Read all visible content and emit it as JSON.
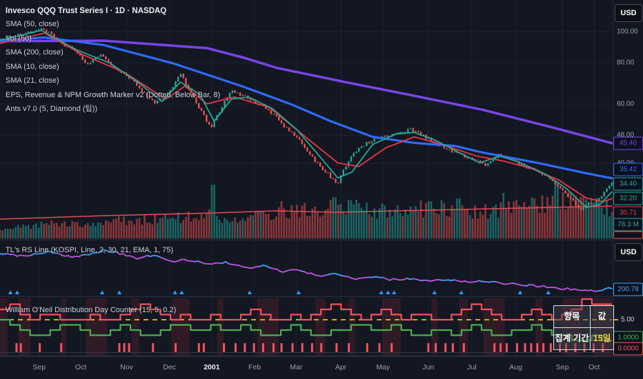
{
  "header": {
    "title": "Invesco QQQ Trust Series I · 1D · NASDAQ"
  },
  "legend": {
    "items": [
      "SMA (50, close)",
      "Vol (50)",
      "SMA (200, close)",
      "SMA (10, close)",
      "SMA (21, close)",
      "EPS, Revenue & NPM Growth Marker v2 (Dotted, Below Bar, 8)",
      "Ants v7.0 (5, Diamond (팁))"
    ]
  },
  "pane_labels": {
    "rs": "TL's RS Line (KOSPI, Line, 2, 30, 21, EMA, 1, 75)",
    "dd": "William O'Neil Distribution Day Counter (15, 5, 0.2)"
  },
  "axis": {
    "currency_main": "USD",
    "currency_rs": "USD"
  },
  "table": {
    "header": [
      "항목",
      "값"
    ],
    "rows": [
      [
        "집계 기간",
        "15일"
      ]
    ]
  },
  "colors": {
    "bg": "#131722",
    "grid": "#1d2330",
    "divider": "#262b38",
    "up": "#26a69a",
    "down": "#ef5350",
    "sma200": "#7646e6",
    "sma50": "#2f6bff",
    "sma21": "#f23645",
    "sma10": "#22ab94",
    "volma": "#e84a5a",
    "rs_blue": "#45a3ff",
    "rs_purple": "#c353e0",
    "triangle": "#2d9cff",
    "dd_red": "#f7525f",
    "dd_green": "#4caf50",
    "dashed": "#e8a408",
    "badge_text_up": "#3dd2b8",
    "yellow": "#f5d342"
  },
  "chart_data": [
    {
      "type": "candlestick",
      "symbol": "Invesco QQQ Trust Series I",
      "interval": "1D",
      "exchange": "NASDAQ",
      "y_scale": "log",
      "y_ticks": [
        {
          "label": "100.00",
          "y": 46
        },
        {
          "label": "80.00",
          "y": 91
        },
        {
          "label": "60.00",
          "y": 151
        },
        {
          "label": "48.00",
          "y": 196
        },
        {
          "label": "40.00",
          "y": 237
        }
      ],
      "x_labels": [
        {
          "label": "Sep",
          "f": 0.064
        },
        {
          "label": "Oct",
          "f": 0.132
        },
        {
          "label": "Nov",
          "f": 0.207
        },
        {
          "label": "Dec",
          "f": 0.277
        },
        {
          "label": "2001",
          "f": 0.346,
          "major": true
        },
        {
          "label": "Feb",
          "f": 0.416
        },
        {
          "label": "Mar",
          "f": 0.484
        },
        {
          "label": "Apr",
          "f": 0.557
        },
        {
          "label": "May",
          "f": 0.626
        },
        {
          "label": "Jun",
          "f": 0.7
        },
        {
          "label": "Jul",
          "f": 0.771
        },
        {
          "label": "Aug",
          "f": 0.843
        },
        {
          "label": "Sep",
          "f": 0.919
        },
        {
          "label": "Oct",
          "f": 0.971
        }
      ],
      "price_anchors": [
        [
          0,
          95
        ],
        [
          0.051,
          99.5
        ],
        [
          0.073,
          102
        ],
        [
          0.096,
          93
        ],
        [
          0.124,
          87
        ],
        [
          0.141,
          79
        ],
        [
          0.163,
          85
        ],
        [
          0.18,
          79
        ],
        [
          0.209,
          73
        ],
        [
          0.231,
          66
        ],
        [
          0.254,
          60
        ],
        [
          0.276,
          65
        ],
        [
          0.295,
          74
        ],
        [
          0.321,
          60
        ],
        [
          0.344,
          50.5
        ],
        [
          0.359,
          57
        ],
        [
          0.378,
          66
        ],
        [
          0.4,
          63
        ],
        [
          0.423,
          60
        ],
        [
          0.445,
          56
        ],
        [
          0.468,
          50.5
        ],
        [
          0.49,
          46
        ],
        [
          0.513,
          40.5
        ],
        [
          0.53,
          37.5
        ],
        [
          0.552,
          34
        ],
        [
          0.566,
          39
        ],
        [
          0.586,
          44
        ],
        [
          0.614,
          47
        ],
        [
          0.643,
          48.5
        ],
        [
          0.671,
          50
        ],
        [
          0.699,
          47
        ],
        [
          0.727,
          44
        ],
        [
          0.75,
          42
        ],
        [
          0.772,
          40.5
        ],
        [
          0.795,
          38.5
        ],
        [
          0.814,
          42
        ],
        [
          0.843,
          39.5
        ],
        [
          0.874,
          37.5
        ],
        [
          0.902,
          35
        ],
        [
          0.925,
          31.5
        ],
        [
          0.949,
          28.5
        ],
        [
          0.964,
          29.5
        ],
        [
          0.979,
          30.5
        ],
        [
          0.992,
          33
        ],
        [
          1,
          34.4
        ]
      ],
      "overlays": {
        "sma200": [
          [
            0,
            93.5
          ],
          [
            0.169,
            93.8
          ],
          [
            0.338,
            89
          ],
          [
            0.4,
            83
          ],
          [
            0.451,
            77.5
          ],
          [
            0.564,
            70
          ],
          [
            0.677,
            63.5
          ],
          [
            0.789,
            57.5
          ],
          [
            0.902,
            50.8
          ],
          [
            1,
            45.4
          ]
        ],
        "sma50": [
          [
            0,
            94
          ],
          [
            0.073,
            96
          ],
          [
            0.169,
            91
          ],
          [
            0.282,
            80
          ],
          [
            0.395,
            68
          ],
          [
            0.474,
            60
          ],
          [
            0.541,
            53
          ],
          [
            0.609,
            47.5
          ],
          [
            0.677,
            45.5
          ],
          [
            0.744,
            44.5
          ],
          [
            0.789,
            42.5
          ],
          [
            0.879,
            39.5
          ],
          [
            0.958,
            36.7
          ],
          [
            1,
            35.42
          ]
        ],
        "sma21": [
          [
            0,
            92
          ],
          [
            0.073,
            99
          ],
          [
            0.135,
            85
          ],
          [
            0.203,
            75
          ],
          [
            0.271,
            62
          ],
          [
            0.302,
            68
          ],
          [
            0.338,
            60
          ],
          [
            0.383,
            63
          ],
          [
            0.44,
            58.5
          ],
          [
            0.496,
            48
          ],
          [
            0.552,
            39.5
          ],
          [
            0.586,
            38.5
          ],
          [
            0.631,
            44
          ],
          [
            0.677,
            47.5
          ],
          [
            0.722,
            45
          ],
          [
            0.778,
            41.5
          ],
          [
            0.823,
            40
          ],
          [
            0.868,
            38
          ],
          [
            0.913,
            35
          ],
          [
            0.958,
            30.8
          ],
          [
            0.986,
            30
          ],
          [
            1,
            30.71
          ]
        ],
        "sma10": [
          [
            0,
            94
          ],
          [
            0.068,
            101
          ],
          [
            0.124,
            88
          ],
          [
            0.18,
            80
          ],
          [
            0.225,
            70
          ],
          [
            0.265,
            61
          ],
          [
            0.295,
            70
          ],
          [
            0.327,
            64
          ],
          [
            0.35,
            53
          ],
          [
            0.378,
            62
          ],
          [
            0.406,
            63
          ],
          [
            0.445,
            58
          ],
          [
            0.485,
            50
          ],
          [
            0.524,
            41
          ],
          [
            0.552,
            35.5
          ],
          [
            0.575,
            37
          ],
          [
            0.609,
            45
          ],
          [
            0.648,
            48.5
          ],
          [
            0.677,
            49
          ],
          [
            0.71,
            46.5
          ],
          [
            0.75,
            42.5
          ],
          [
            0.784,
            39.5
          ],
          [
            0.817,
            41.5
          ],
          [
            0.851,
            39.5
          ],
          [
            0.891,
            36.5
          ],
          [
            0.925,
            33
          ],
          [
            0.958,
            28.8
          ],
          [
            0.981,
            29.5
          ],
          [
            1,
            32.2
          ]
        ]
      },
      "volume": {
        "anchors": [
          [
            0,
            14
          ],
          [
            0.05,
            18
          ],
          [
            0.1,
            22
          ],
          [
            0.15,
            20
          ],
          [
            0.2,
            26
          ],
          [
            0.25,
            28
          ],
          [
            0.3,
            30
          ],
          [
            0.34,
            34
          ],
          [
            0.36,
            30
          ],
          [
            0.4,
            32
          ],
          [
            0.45,
            36
          ],
          [
            0.48,
            38
          ],
          [
            0.52,
            42
          ],
          [
            0.55,
            46
          ],
          [
            0.58,
            42
          ],
          [
            0.62,
            40
          ],
          [
            0.65,
            38
          ],
          [
            0.68,
            42
          ],
          [
            0.72,
            44
          ],
          [
            0.75,
            40
          ],
          [
            0.8,
            38
          ],
          [
            0.85,
            46
          ],
          [
            0.9,
            52
          ],
          [
            0.94,
            56
          ],
          [
            0.97,
            48
          ],
          [
            1,
            42
          ]
        ],
        "spikes": [
          [
            0.349,
            78,
            "up"
          ],
          [
            0.46,
            54,
            "down"
          ],
          [
            0.545,
            60,
            "up"
          ],
          [
            0.582,
            56,
            "up"
          ],
          [
            0.703,
            54,
            "up"
          ],
          [
            0.748,
            58,
            "up"
          ],
          [
            0.823,
            66,
            "up"
          ],
          [
            0.908,
            82,
            "up"
          ],
          [
            0.952,
            60,
            "down"
          ]
        ],
        "ma_anchors": [
          [
            0,
            29
          ],
          [
            0.17,
            34
          ],
          [
            0.35,
            38
          ],
          [
            0.45,
            41
          ],
          [
            0.55,
            39
          ],
          [
            0.65,
            41
          ],
          [
            0.75,
            43
          ],
          [
            0.85,
            45
          ],
          [
            1,
            48
          ]
        ],
        "last": "78.3 M"
      },
      "last_values": {
        "close": "34.40",
        "sma200": "45.40",
        "sma50": "35.42",
        "sma10": "32.20",
        "sma21": "30.71",
        "volume": "78.3 M"
      },
      "badges": [
        {
          "label": "45.40",
          "color": "sma200",
          "y": 208
        },
        {
          "label": "35.42",
          "color": "sma50",
          "y": 246
        },
        {
          "label": "34.40",
          "color": "up",
          "y": 267
        },
        {
          "label": "32.20",
          "color": "sma10",
          "y": 288
        },
        {
          "label": "30.71",
          "color": "sma21",
          "y": 309
        },
        {
          "label": "78.3 M",
          "color": "up",
          "y": 326
        }
      ]
    },
    {
      "type": "line",
      "name": "TL's RS Line",
      "params": [
        "KOSPI",
        "Line",
        2,
        30,
        21,
        "EMA",
        1,
        75
      ],
      "anchors": [
        [
          0,
          16
        ],
        [
          0.04,
          20
        ],
        [
          0.08,
          13
        ],
        [
          0.12,
          21
        ],
        [
          0.15,
          16
        ],
        [
          0.17,
          11
        ],
        [
          0.19,
          14
        ],
        [
          0.22,
          23
        ],
        [
          0.25,
          19
        ],
        [
          0.28,
          27
        ],
        [
          0.31,
          25
        ],
        [
          0.34,
          32
        ],
        [
          0.37,
          29
        ],
        [
          0.4,
          37
        ],
        [
          0.43,
          34
        ],
        [
          0.46,
          42
        ],
        [
          0.49,
          40
        ],
        [
          0.52,
          48
        ],
        [
          0.55,
          45
        ],
        [
          0.58,
          52
        ],
        [
          0.61,
          50
        ],
        [
          0.64,
          54
        ],
        [
          0.67,
          52
        ],
        [
          0.7,
          56
        ],
        [
          0.73,
          54
        ],
        [
          0.76,
          57
        ],
        [
          0.79,
          55
        ],
        [
          0.82,
          59
        ],
        [
          0.85,
          61
        ],
        [
          0.88,
          63
        ],
        [
          0.91,
          66
        ],
        [
          0.94,
          68
        ],
        [
          0.97,
          70
        ],
        [
          1,
          66
        ]
      ],
      "triangles": [
        0.017,
        0.028,
        0.167,
        0.195,
        0.286,
        0.297,
        0.408,
        0.488,
        0.623,
        0.634,
        0.644,
        0.71,
        0.754,
        0.85,
        0.896
      ],
      "last_value": "200.78"
    },
    {
      "type": "step-line",
      "name": "William O'Neil Distribution Day Counter",
      "params": [
        15,
        5,
        0.2
      ],
      "threshold": {
        "label": "5.00",
        "value": 5
      },
      "red_steps": [
        7,
        8,
        6,
        5,
        6,
        6,
        5,
        5,
        5,
        6,
        5,
        5,
        6,
        7,
        8,
        7,
        6,
        5,
        6,
        5,
        5,
        6,
        5,
        5,
        6,
        7,
        6,
        5,
        5,
        6,
        5,
        6,
        7,
        8,
        7,
        6,
        5,
        6,
        7,
        6,
        5,
        6,
        6,
        5,
        5,
        6,
        7,
        8,
        7,
        6,
        5,
        5,
        6,
        7,
        6,
        5,
        6,
        7,
        9,
        8,
        8
      ],
      "green_steps": [
        5,
        4,
        3,
        2,
        2,
        3,
        4,
        4,
        3,
        2,
        2,
        3,
        4,
        3,
        2,
        2,
        3,
        4,
        4,
        3,
        3,
        4,
        3,
        3,
        4,
        3,
        2,
        2,
        3,
        4,
        3,
        2,
        2,
        3,
        3,
        4,
        4,
        3,
        3,
        4,
        3,
        2,
        2,
        3,
        3,
        2,
        3,
        4,
        3,
        2,
        2,
        3,
        3,
        4,
        3,
        2,
        2,
        1,
        1,
        2,
        1
      ],
      "histogram_x": [
        0.027,
        0.034,
        0.065,
        0.1,
        0.195,
        0.203,
        0.211,
        0.25,
        0.287,
        0.325,
        0.333,
        0.366,
        0.385,
        0.4,
        0.415,
        0.43,
        0.447,
        0.46,
        0.478,
        0.494,
        0.51,
        0.525,
        0.55,
        0.57,
        0.6,
        0.62,
        0.64,
        0.7,
        0.712,
        0.728,
        0.74,
        0.758,
        0.808,
        0.818,
        0.828,
        0.845,
        0.858,
        0.868,
        0.878,
        0.888,
        0.9,
        0.915,
        0.925,
        0.94,
        0.955,
        0.97,
        0.985
      ],
      "bg_columns": [
        [
          0,
          0.012
        ],
        [
          0.03,
          0.02
        ],
        [
          0.1,
          0.008
        ],
        [
          0.14,
          0.035
        ],
        [
          0.215,
          0.012
        ],
        [
          0.28,
          0.03
        ],
        [
          0.355,
          0.01
        ],
        [
          0.42,
          0.035
        ],
        [
          0.515,
          0.017
        ],
        [
          0.57,
          0.01
        ],
        [
          0.625,
          0.03
        ],
        [
          0.705,
          0.01
        ],
        [
          0.75,
          0.015
        ],
        [
          0.79,
          0.035
        ],
        [
          0.875,
          0.012
        ],
        [
          0.92,
          0.03
        ],
        [
          0.97,
          0.03
        ]
      ],
      "last_values": {
        "green": "1.0000",
        "red": "0.0000"
      }
    }
  ]
}
